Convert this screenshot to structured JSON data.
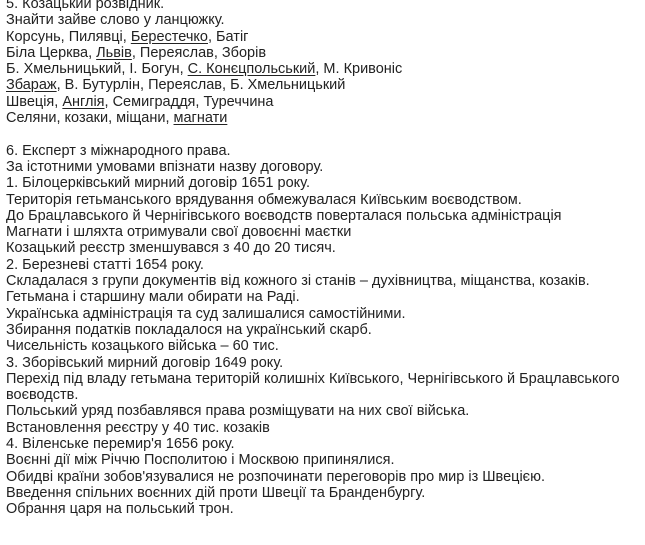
{
  "section5": {
    "title": "5. Козацький розвідник.",
    "task": "Знайти зайве слово у ланцюжку.",
    "rows": [
      [
        {
          "t": "Корсунь, Пилявці, "
        },
        {
          "t": "Берестечко",
          "u": true
        },
        {
          "t": ", Батіг"
        }
      ],
      [
        {
          "t": "Біла Церква, "
        },
        {
          "t": "Львів",
          "u": true
        },
        {
          "t": ", Переяслав, Зборів"
        }
      ],
      [
        {
          "t": "Б. Хмельницький, І. Богун, "
        },
        {
          "t": "С. Конєцпольський",
          "u": true
        },
        {
          "t": ", М. Кривоніс"
        }
      ],
      [
        {
          "t": "Збараж",
          "u": true
        },
        {
          "t": ", В. Бутурлін, Переяслав, Б. Хмельницький"
        }
      ],
      [
        {
          "t": "Швеція, "
        },
        {
          "t": "Англія",
          "u": true
        },
        {
          "t": ", Семиграддя, Туреччина"
        }
      ],
      [
        {
          "t": "Селяни, козаки, міщани, "
        },
        {
          "t": "магнати",
          "u": true
        }
      ]
    ]
  },
  "section6": {
    "title": "6. Експерт з міжнародного права.",
    "task": "За істотними умовами впізнати назву договору.",
    "lines": [
      "1. Білоцерківський мирний договір 1651 року.",
      "Територія гетьманського врядування обмежувалася Київським воєводством.",
      "До Брацлавського й Чернігівського воєводств поверталася польська адміністрація",
      "Магнати і шляхта отримували свої довоєнні маєтки",
      "Козацький реєстр зменшувався з 40 до 20 тисяч.",
      "2. Березневі статті 1654 року.",
      "Складалася з групи документів від кожного зі станів – духівництва, міщанства, козаків.",
      "Гетьмана і старшину мали обирати на Раді.",
      "Українська адміністрація та суд залишалися самостійними.",
      "Збирання податків покладалося на український скарб.",
      "Чисельність козацького війська – 60 тис.",
      "3. Зборівський мирний договір 1649 року.",
      "Перехід під владу гетьмана територій колишніх Київського, Чернігівського й Брацлавського воєводств.",
      "Польський уряд позбавлявся права розміщувати на них свої війська.",
      "Встановлення реєстру у 40 тис. козаків",
      "4. Віленське перемир'я 1656 року.",
      "Воєнні дії між Річчю Посполитою і Москвою припинялися.",
      "Обидві країни зобов'язувалися не розпочинати переговорів про мир із Швецією.",
      "Введення спільних воєнних дій проти Швеції та Бранденбургу.",
      "Обрання царя на польський трон."
    ]
  }
}
